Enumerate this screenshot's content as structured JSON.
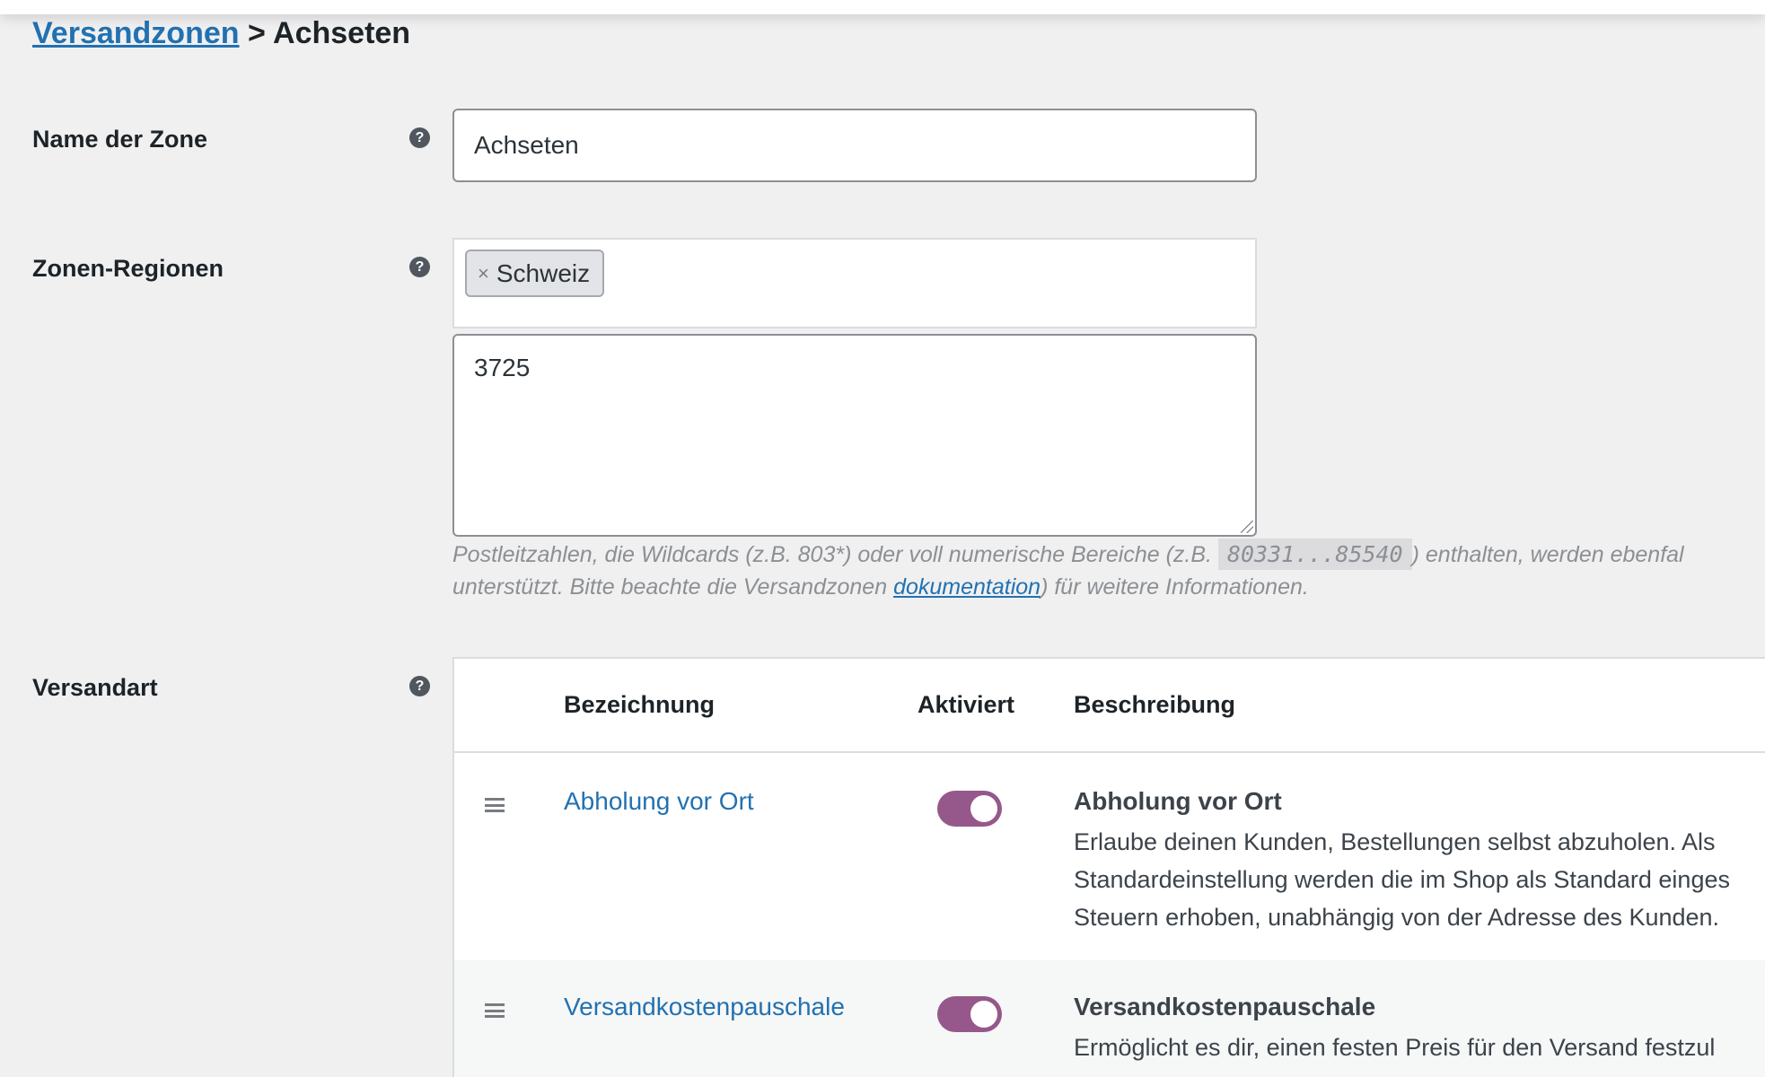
{
  "breadcrumb": {
    "parent": "Versandzonen",
    "separator": ">",
    "current": "Achseten"
  },
  "zone_name": {
    "label": "Name der Zone",
    "value": "Achseten"
  },
  "zone_regions": {
    "label": "Zonen-Regionen",
    "chip_remove": "×",
    "chips": [
      "Schweiz"
    ],
    "postcodes": "3725",
    "hint": {
      "text_before": "Postleitzahlen, die Wildcards (z.B. 803*) oder voll numerische Bereiche (z.B.",
      "example": "80331...85540",
      "text_middle": ") enthalten, werden ebenfal",
      "text_line2": "unterstützt. Bitte beachte die Versandzonen",
      "link": "dokumentation",
      "text_after": ") für weitere Informationen."
    }
  },
  "shipping_methods": {
    "label": "Versandart",
    "columns": {
      "name": "Bezeichnung",
      "enabled": "Aktiviert",
      "description": "Beschreibung"
    },
    "rows": [
      {
        "name": "Abholung vor Ort",
        "enabled": true,
        "desc_title": "Abholung vor Ort",
        "desc_lines": [
          "Erlaube deinen Kunden, Bestellungen selbst abzuholen. Als",
          "Standardeinstellung werden die im Shop als Standard einges",
          "Steuern erhoben, unabhängig von der Adresse des Kunden."
        ]
      },
      {
        "name": "Versandkostenpauschale",
        "enabled": true,
        "desc_title": "Versandkostenpauschale",
        "desc_lines": [
          "Ermöglicht es dir, einen festen Preis für den Versand festzul"
        ]
      }
    ]
  },
  "icons": {
    "help": "?",
    "drag": "drag-handle-icon",
    "toggle_color": "#96588a",
    "link_color": "#2271b1"
  }
}
